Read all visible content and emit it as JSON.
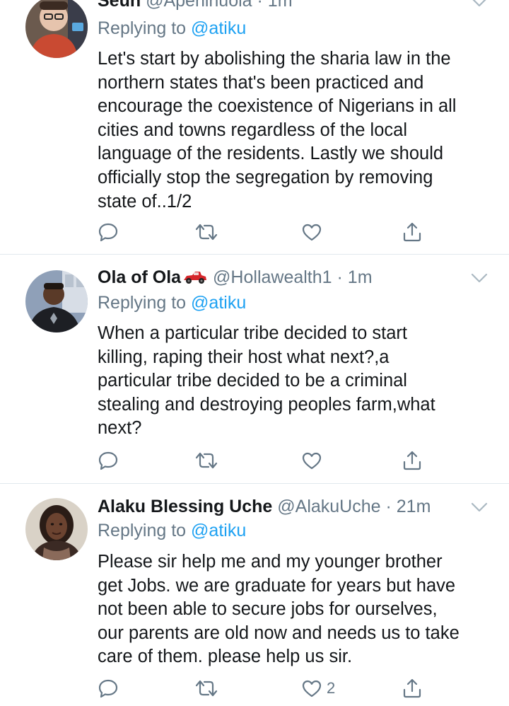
{
  "tweets": [
    {
      "name": "Seun",
      "handle": "@Apeninuola",
      "time": "1m",
      "replying_prefix": "Replying to",
      "replying_to": "@atiku",
      "text": "Let's start by abolishing the sharia law in the\nnorthern states that's been practiced and\nencourage the coexistence of Nigerians in all\ncities and towns regardless of the local\nlanguage of the residents. Lastly we should\nofficially stop the segregation by removing\nstate of..1/2",
      "like_count": ""
    },
    {
      "name": "Ola of Ola",
      "handle": "@Hollawealth1",
      "time": "1m",
      "replying_prefix": "Replying to",
      "replying_to": "@atiku",
      "text": "When a particular tribe decided to start\nkilling, raping their host what next?,a\nparticular tribe decided to be a criminal\nstealing and destroying peoples farm,what\nnext?",
      "like_count": ""
    },
    {
      "name": "Alaku Blessing Uche",
      "handle": "@AlakuUche",
      "time": "21m",
      "replying_prefix": "Replying to",
      "replying_to": "@atiku",
      "text": "Please sir help me and my younger brother\nget  Jobs. we are  graduate for years but have\nnot been able to secure jobs for ourselves,\nour parents are old now and needs us to take\ncare of them. please help us sir.",
      "like_count": "2"
    }
  ],
  "colors": {
    "accent": "#1da1f2",
    "secondary_text": "#657786",
    "divider": "#e1e8ed"
  },
  "icons": [
    "reply-icon",
    "retweet-icon",
    "like-icon",
    "share-icon",
    "chevron-down-icon",
    "race-car-emoji"
  ]
}
